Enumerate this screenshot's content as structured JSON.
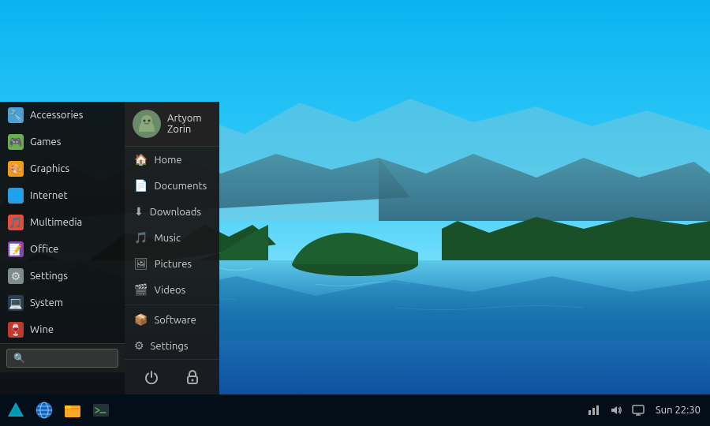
{
  "desktop": {
    "background": "lake-mountains-blue-sky"
  },
  "taskbar": {
    "datetime": "Sun 22:30",
    "icons": [
      {
        "name": "zorin-menu",
        "label": "Zorin Menu"
      },
      {
        "name": "browser",
        "label": "Browser"
      },
      {
        "name": "files",
        "label": "Files"
      },
      {
        "name": "terminal",
        "label": "Terminal"
      }
    ]
  },
  "start_menu": {
    "user": {
      "name": "Artyom Zorin"
    },
    "left_items": [
      {
        "id": "accessories",
        "label": "Accessories",
        "icon_class": "icon-accessories"
      },
      {
        "id": "games",
        "label": "Games",
        "icon_class": "icon-games"
      },
      {
        "id": "graphics",
        "label": "Graphics",
        "icon_class": "icon-graphics"
      },
      {
        "id": "internet",
        "label": "Internet",
        "icon_class": "icon-internet"
      },
      {
        "id": "multimedia",
        "label": "Multimedia",
        "icon_class": "icon-multimedia"
      },
      {
        "id": "office",
        "label": "Office",
        "icon_class": "icon-office"
      },
      {
        "id": "settings",
        "label": "Settings",
        "icon_class": "icon-settings"
      },
      {
        "id": "system",
        "label": "System",
        "icon_class": "icon-system"
      },
      {
        "id": "wine",
        "label": "Wine",
        "icon_class": "icon-wine"
      }
    ],
    "right_items": [
      {
        "id": "home",
        "label": "Home",
        "icon": "🏠"
      },
      {
        "id": "documents",
        "label": "Documents",
        "icon": "📄"
      },
      {
        "id": "downloads",
        "label": "Downloads",
        "icon": "⬇"
      },
      {
        "id": "music",
        "label": "Music",
        "icon": "🎵"
      },
      {
        "id": "pictures",
        "label": "Pictures",
        "icon": "🖼"
      },
      {
        "id": "videos",
        "label": "Videos",
        "icon": "🎬"
      },
      {
        "id": "software",
        "label": "Software",
        "icon": "📦"
      },
      {
        "id": "settings",
        "label": "Settings",
        "icon": "⚙"
      }
    ],
    "search_placeholder": "🔍",
    "bottom_actions": [
      {
        "id": "power",
        "icon": "⏻",
        "label": "Power"
      },
      {
        "id": "lock",
        "icon": "🔒",
        "label": "Lock"
      }
    ]
  }
}
